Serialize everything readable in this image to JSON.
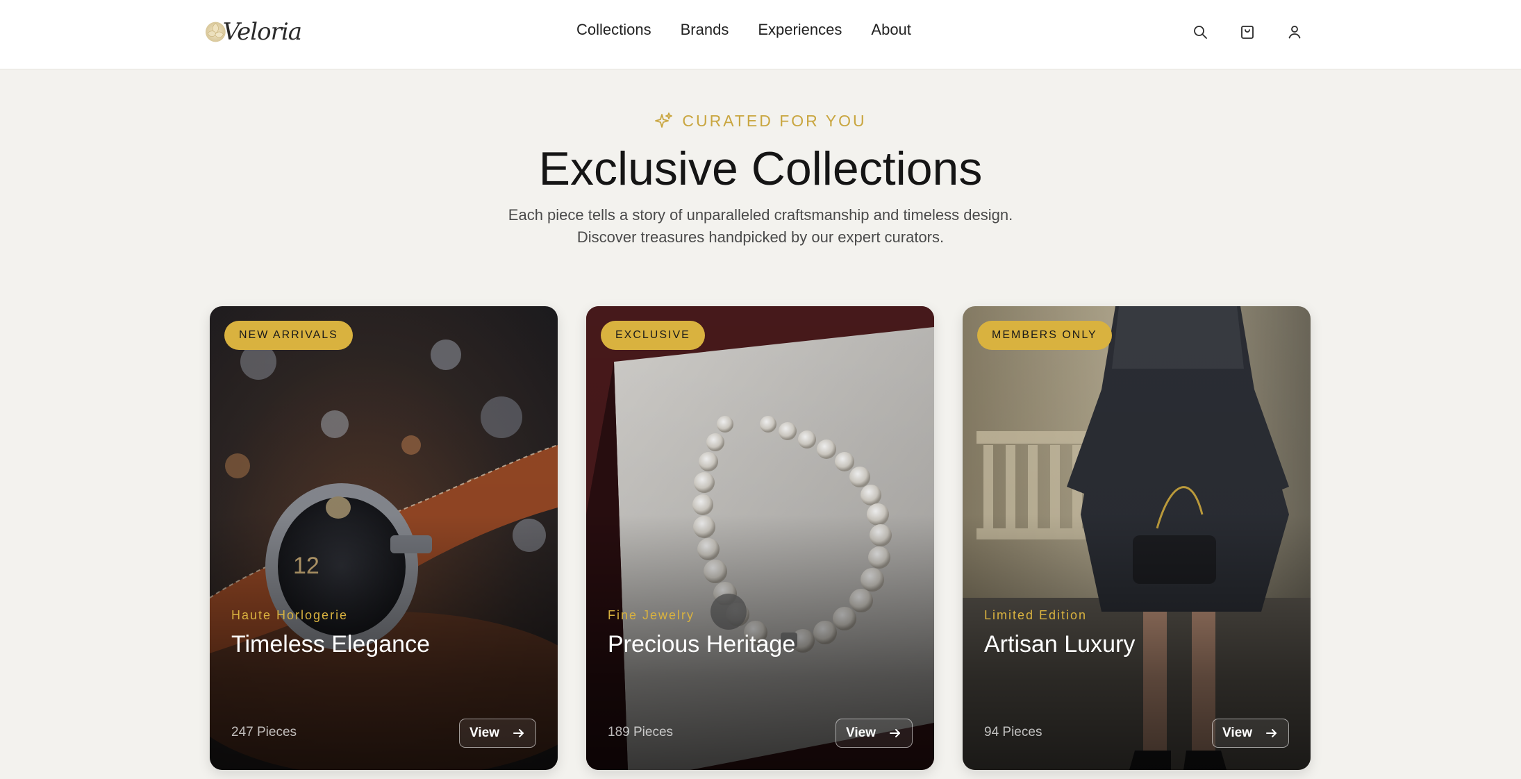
{
  "brand": {
    "name": "Veloria"
  },
  "nav": [
    {
      "label": "Collections"
    },
    {
      "label": "Brands"
    },
    {
      "label": "Experiences"
    },
    {
      "label": "About"
    }
  ],
  "header_icons": [
    "search-icon",
    "shopping-bag-icon",
    "user-icon"
  ],
  "intro": {
    "eyebrow": "CURATED FOR YOU",
    "title": "Exclusive Collections",
    "subtitle": "Each piece tells a story of unparalleled craftsmanship and timeless design. Discover treasures handpicked by our expert curators."
  },
  "cards": [
    {
      "badge": "NEW ARRIVALS",
      "category": "Haute Horlogerie",
      "title": "Timeless Elegance",
      "count": "247 Pieces",
      "button": "View"
    },
    {
      "badge": "EXCLUSIVE",
      "category": "Fine Jewelry",
      "title": "Precious Heritage",
      "count": "189 Pieces",
      "button": "View"
    },
    {
      "badge": "MEMBERS ONLY",
      "category": "Limited Edition",
      "title": "Artisan Luxury",
      "count": "94 Pieces",
      "button": "View"
    }
  ],
  "colors": {
    "accent": "#d9b23f",
    "background": "#f3f2ee"
  }
}
